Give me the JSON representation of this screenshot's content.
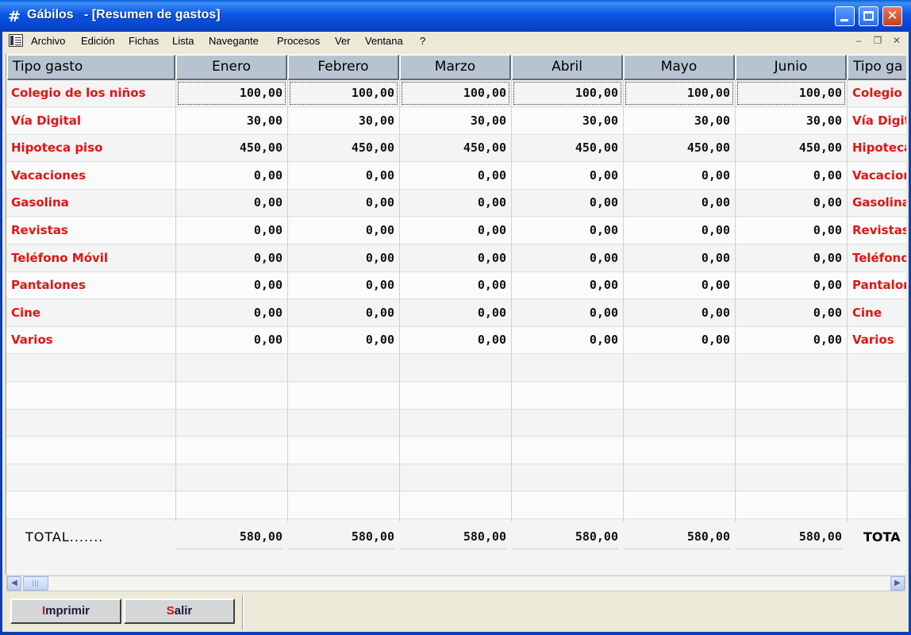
{
  "window": {
    "app_name": "Gábilos",
    "doc_title": "- [Resumen de gastos]",
    "icon": "hash-grid-icon"
  },
  "menu": [
    "Archivo",
    "Edición",
    "Fichas",
    "Lista",
    "Navegante",
    "Procesos",
    "Ver",
    "Ventana",
    "?"
  ],
  "table": {
    "label_header": "Tipo gasto",
    "months": [
      "Enero",
      "Febrero",
      "Marzo",
      "Abril",
      "Mayo",
      "Junio"
    ],
    "right_header": "Tipo ga",
    "rows": [
      {
        "label": "Colegio de los niños",
        "values": [
          "100,00",
          "100,00",
          "100,00",
          "100,00",
          "100,00",
          "100,00"
        ],
        "right": "Colegio d"
      },
      {
        "label": "Vía Digital",
        "values": [
          "30,00",
          "30,00",
          "30,00",
          "30,00",
          "30,00",
          "30,00"
        ],
        "right": "Vía Digit"
      },
      {
        "label": "Hipoteca piso",
        "values": [
          "450,00",
          "450,00",
          "450,00",
          "450,00",
          "450,00",
          "450,00"
        ],
        "right": "Hipoteca"
      },
      {
        "label": "Vacaciones",
        "values": [
          "0,00",
          "0,00",
          "0,00",
          "0,00",
          "0,00",
          "0,00"
        ],
        "right": "Vacacion"
      },
      {
        "label": "Gasolina",
        "values": [
          "0,00",
          "0,00",
          "0,00",
          "0,00",
          "0,00",
          "0,00"
        ],
        "right": "Gasolina"
      },
      {
        "label": "Revistas",
        "values": [
          "0,00",
          "0,00",
          "0,00",
          "0,00",
          "0,00",
          "0,00"
        ],
        "right": "Revistas"
      },
      {
        "label": "Teléfono Móvil",
        "values": [
          "0,00",
          "0,00",
          "0,00",
          "0,00",
          "0,00",
          "0,00"
        ],
        "right": "Teléfono"
      },
      {
        "label": "Pantalones",
        "values": [
          "0,00",
          "0,00",
          "0,00",
          "0,00",
          "0,00",
          "0,00"
        ],
        "right": "Pantalon"
      },
      {
        "label": "Cine",
        "values": [
          "0,00",
          "0,00",
          "0,00",
          "0,00",
          "0,00",
          "0,00"
        ],
        "right": "Cine"
      },
      {
        "label": "Varios",
        "values": [
          "0,00",
          "0,00",
          "0,00",
          "0,00",
          "0,00",
          "0,00"
        ],
        "right": "Varios"
      }
    ],
    "total_label": "TOTAL.......",
    "totals": [
      "580,00",
      "580,00",
      "580,00",
      "580,00",
      "580,00",
      "580,00"
    ],
    "total_right": "TOTA"
  },
  "buttons": {
    "print_hot": "I",
    "print_rest": "mprimir",
    "exit_hot": "S",
    "exit_rest": "alir"
  },
  "colors": {
    "label_text": "#e21414",
    "header_bg": "#b7c4cf",
    "titlebar": "#0a55e3"
  }
}
